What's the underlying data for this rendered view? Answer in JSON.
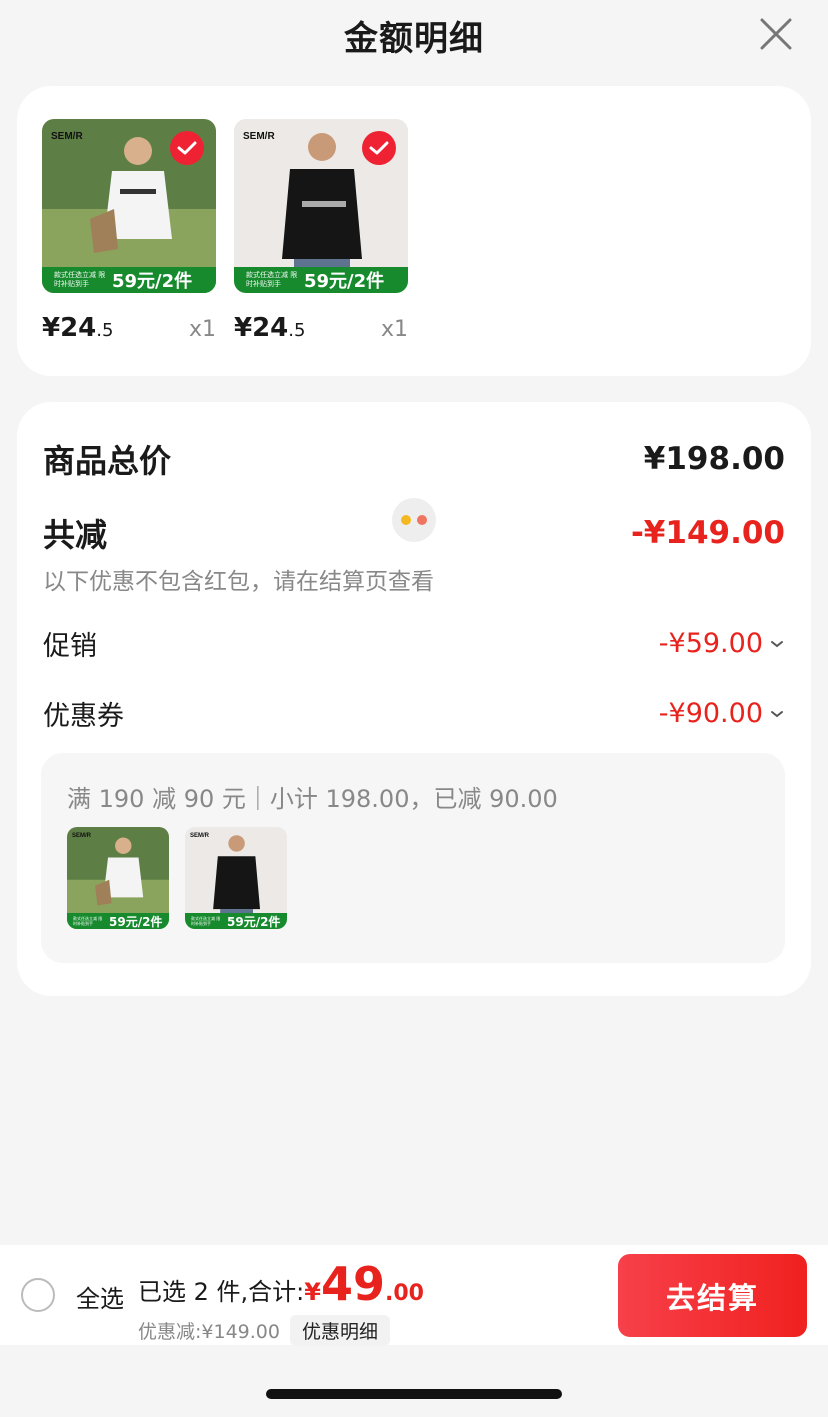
{
  "header": {
    "title": "金额明细"
  },
  "products": [
    {
      "brand": "SEM/R",
      "promo_small": "款式任选立减 限时补贴到手",
      "promo_big": "59元/2件",
      "price_int": "¥24",
      "price_dec": ".5",
      "qty": "x1",
      "shirt_color": "#f4f4f4",
      "bg": "#4f7a3a"
    },
    {
      "brand": "SEM/R",
      "promo_small": "款式任选立减 限时补贴到手",
      "promo_big": "59元/2件",
      "price_int": "¥24",
      "price_dec": ".5",
      "qty": "x1",
      "shirt_color": "#151515",
      "bg": "#ece9e6"
    }
  ],
  "summary": {
    "total_label": "商品总价",
    "total_value": "¥198.00",
    "reduce_label": "共减",
    "reduce_value": "-¥149.00",
    "note": "以下优惠不包含红包，请在结算页查看",
    "promo_label": "促销",
    "promo_value": "-¥59.00",
    "coupon_label": "优惠券",
    "coupon_value": "-¥90.00",
    "coupon_detail": "满 190 减 90 元｜小计 198.00，已减 90.00"
  },
  "bottom": {
    "select_all": "全选",
    "selected_text": "已选 2 件,合计:",
    "total_symbol": "¥",
    "total_int": "49",
    "total_dec": ".00",
    "discount_text": "优惠减:¥149.00",
    "detail_button": "优惠明细",
    "checkout_button": "去结算"
  },
  "colors": {
    "accent_red": "#e8231d",
    "promo_green": "#178a2e"
  }
}
